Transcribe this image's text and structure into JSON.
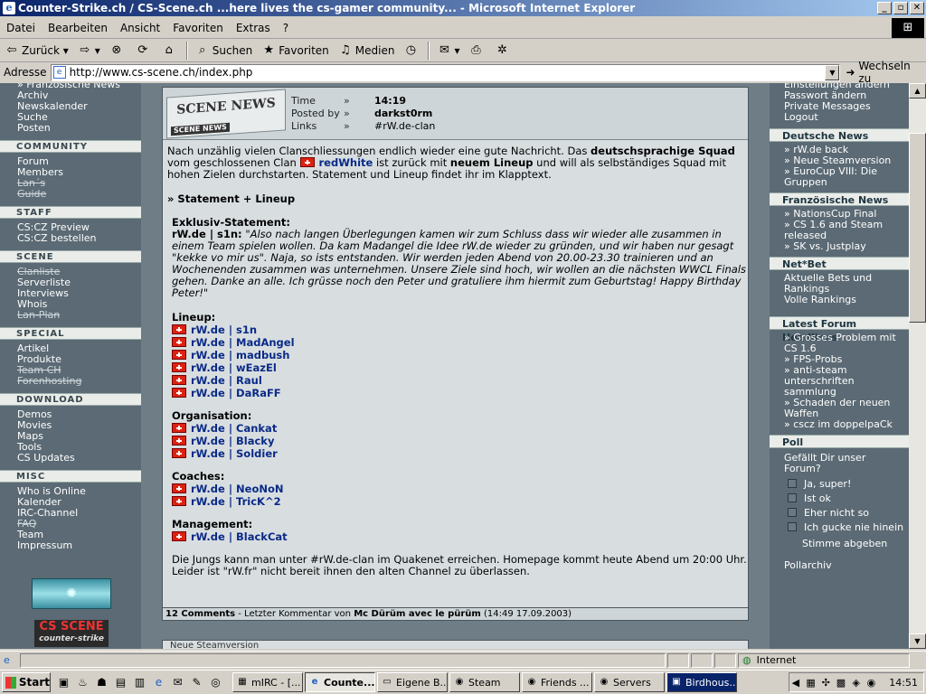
{
  "window": {
    "title": "Counter-Strike.ch / CS-Scene.ch ...here lives the cs-gamer community... - Microsoft Internet Explorer",
    "minimize": "_",
    "maximize": "▫",
    "close": "✕"
  },
  "menu": [
    "Datei",
    "Bearbeiten",
    "Ansicht",
    "Favoriten",
    "Extras",
    "?"
  ],
  "toolbar": {
    "back": "Zurück",
    "search": "Suchen",
    "favorites": "Favoriten",
    "media": "Medien"
  },
  "address": {
    "label": "Adresse",
    "url": "http://www.cs-scene.ch/index.php",
    "go": "Wechseln zu"
  },
  "leftnav": {
    "top_items": [
      "» Französische News",
      "Archiv",
      "Newskalender",
      "Suche",
      "Posten"
    ],
    "community": {
      "title": "COMMUNITY",
      "items": [
        "Forum",
        "Members",
        "Lan´s",
        "Guide"
      ]
    },
    "staff": {
      "title": "STAFF",
      "items": [
        "CS:CZ Preview",
        "CS:CZ bestellen"
      ]
    },
    "scene": {
      "title": "SCENE",
      "items": [
        "Clanliste",
        "Serverliste",
        "Interviews",
        "Whois",
        "Lan-Plan"
      ]
    },
    "special": {
      "title": "SPECIAL",
      "items": [
        "Artikel",
        "Produkte",
        "Team CH",
        "Forenhosting"
      ]
    },
    "download": {
      "title": "DOWNLOAD",
      "items": [
        "Demos",
        "Movies",
        "Maps",
        "Tools",
        "CS Updates"
      ]
    },
    "misc": {
      "title": "MISC",
      "items": [
        "Who is Online",
        "Kalender",
        "IRC-Channel",
        "FAQ",
        "Team",
        "Impressum"
      ]
    },
    "banner2_a": "CS SCENE",
    "banner2_b": "counter-strike"
  },
  "news": {
    "logo_text": "SCENE NEWS",
    "logo_sub": "SCENE NEWS",
    "meta": [
      {
        "k": "Time",
        "v": "14:19"
      },
      {
        "k": "Posted by",
        "v": "darkst0rm"
      },
      {
        "k": "Links",
        "v": "#rW.de-clan"
      }
    ],
    "meta_arrow": "»",
    "intro_1": "Nach unzählig vielen Clanschliessungen endlich wieder eine gute Nachricht. Das ",
    "intro_bold_1": "deutschsprachige Squad",
    "intro_2": " vom geschlossenen Clan ",
    "intro_clan": "redWhite",
    "intro_3": " ist zurück mit ",
    "intro_bold_2": "neuem Lineup",
    "intro_4": " und will als selbständiges Squad mit hohen Zielen durchstarten. Statement und Lineup findet ihr im Klapptext.",
    "toggle": "» Statement + Lineup",
    "statement_title": "Exklusiv-Statement:",
    "statement_author": "rW.de | s1n:",
    "statement_text": " \"Also nach langen Überlegungen kamen wir zum Schluss dass wir wieder alle zusammen in einem Team spielen wollen. Da kam Madangel die Idee rW.de wieder zu gründen, und wir haben nur gesagt \"kekke vo mir us\". Naja, so ists entstanden. Wir werden jeden Abend von 20.00-23.30 trainieren und an Wochenenden zusammen was unternehmen. Unsere Ziele sind hoch, wir wollen an die nächsten WWCL Finals gehen. Danke an alle. Ich grüsse noch den Peter und gratuliere ihm hiermit zum Geburtstag! Happy Birthday Peter!\"",
    "lineup_title": "Lineup:",
    "lineup": [
      "rW.de | s1n",
      "rW.de | MadAngel",
      "rW.de | madbush",
      "rW.de | wEazEl",
      "rW.de | Raul",
      "rW.de | DaRaFF"
    ],
    "org_title": "Organisation:",
    "organisation": [
      "rW.de | Cankat",
      "rW.de | Blacky",
      "rW.de | Soldier"
    ],
    "coach_title": "Coaches:",
    "coaches": [
      "rW.de | NeoNoN",
      "rW.de | TricK^2"
    ],
    "mgmt_title": "Management:",
    "management": [
      "rW.de | BlackCat"
    ],
    "outro": "Die Jungs kann man unter #rW.de-clan im Quakenet erreichen. Homepage kommt heute Abend um 20:00 Uhr. Leider ist \"rW.fr\" nicht bereit ihnen den alten Channel zu überlassen.",
    "comments": "12 Comments",
    "last_comment_pre": " - Letzter Kommentar von ",
    "last_comment_by": "Mc Dürüm avec le pürüm",
    "last_comment_time": " (14:49 17.09.2003)",
    "next_title": "Neue Steamversion"
  },
  "rightnav": {
    "top_items": [
      "Einstellungen ändern",
      "Passwort ändern",
      "Private Messages",
      "Logout"
    ],
    "de": {
      "title": "Deutsche News",
      "items": [
        "» rW.de back",
        "» Neue Steamversion",
        "» EuroCup VIII: Die Gruppen"
      ]
    },
    "fr": {
      "title": "Französische News",
      "items": [
        "» NationsCup Final",
        "» CS 1.6 and Steam released",
        "» SK vs. Justplay"
      ]
    },
    "netbet": {
      "title": "Net*Bet",
      "items": [
        "Aktuelle Bets und Rankings",
        "Volle Rankings"
      ]
    },
    "forum": {
      "title": "Latest Forum Headlines",
      "items": [
        "» Grosses Problem mit CS 1.6",
        "» FPS-Probs",
        "» anti-steam unterschriften sammlung",
        "» Schaden der neuen Waffen",
        "» cscz im doppelpaCk"
      ]
    },
    "poll": {
      "title": "Poll",
      "question": "Gefällt Dir unser Forum?",
      "options": [
        "Ja, super!",
        "Ist ok",
        "Eher nicht so",
        "Ich gucke nie hinein"
      ],
      "vote": "Stimme abgeben",
      "archive": "Pollarchiv"
    }
  },
  "status": {
    "zone": "Internet"
  },
  "taskbar": {
    "start": "Start",
    "tasks": [
      "mIRC - [...",
      "Counte...",
      "Eigene B...",
      "Steam",
      "Friends ...",
      "Servers",
      "Birdhous..."
    ],
    "clock": "14:51"
  }
}
